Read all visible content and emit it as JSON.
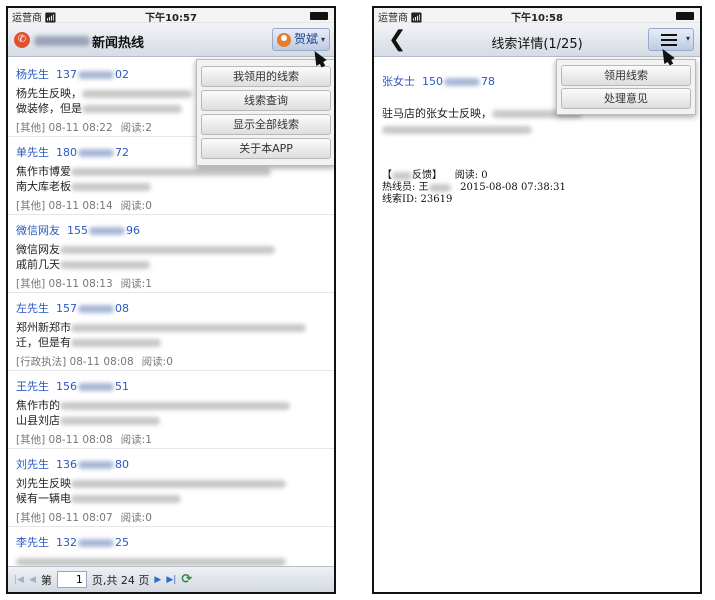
{
  "status_bar": {
    "carrier": "运营商",
    "wifi_icon": "wifi-icon",
    "time_left": "下午10:57",
    "time_right": "下午10:58"
  },
  "left": {
    "app_title": "新闻热线",
    "user_name": "贺斌",
    "menu": [
      "我领用的线索",
      "线索查询",
      "显示全部线索",
      "关于本APP"
    ],
    "items": [
      {
        "name": "杨先生",
        "phone_start": "137",
        "phone_end": "02",
        "line1": "杨先生反映，",
        "line2": "做装修，但是",
        "category": "[其他]",
        "time": "08-11 08:22",
        "read": "阅读:2"
      },
      {
        "name": "单先生",
        "phone_start": "180",
        "phone_end": "72",
        "line1": "焦作市博爱",
        "line2": "南大库老板",
        "category": "[其他]",
        "time": "08-11 08:14",
        "read": "阅读:0"
      },
      {
        "name": "微信网友",
        "phone_start": "155",
        "phone_end": "96",
        "line1": "微信网友",
        "line2": "戚前几天",
        "category": "[其他]",
        "time": "08-11 08:13",
        "read": "阅读:1"
      },
      {
        "name": "左先生",
        "phone_start": "157",
        "phone_end": "08",
        "line1": "郑州新郑市",
        "line2": "迁，但是有",
        "category": "[行政执法]",
        "time": "08-11 08:08",
        "read": "阅读:0"
      },
      {
        "name": "王先生",
        "phone_start": "156",
        "phone_end": "51",
        "line1": "焦作市的",
        "line2": "山县刘店",
        "category": "[其他]",
        "time": "08-11 08:08",
        "read": "阅读:1"
      },
      {
        "name": "刘先生",
        "phone_start": "136",
        "phone_end": "80",
        "line1": "刘先生反映",
        "line2": "候有一辆电",
        "category": "[其他]",
        "time": "08-11 08:07",
        "read": "阅读:0"
      },
      {
        "name": "李先生",
        "phone_start": "132",
        "phone_end": "25",
        "line1": "",
        "line2": "",
        "category": "",
        "time": "",
        "read": ""
      }
    ],
    "pager": {
      "prefix": "第",
      "page": "1",
      "suffix": "页,共 24 页"
    }
  },
  "right": {
    "title": "线索详情(1/25)",
    "menu": [
      "领用线索",
      "处理意见"
    ],
    "contact_name": "张女士",
    "phone_start": "150",
    "phone_end": "78",
    "body": "驻马店的张女士反映，",
    "feedback_open": "【",
    "feedback_close": "反馈】",
    "read_label": "阅读: 0",
    "operator_label": "热线员: 王",
    "operator_time": "2015-08-08 07:38:31",
    "clue_id": "线索ID: 23619"
  },
  "colors": {
    "accent_blue": "#2a57c0",
    "navbar": "#d6dce4"
  }
}
